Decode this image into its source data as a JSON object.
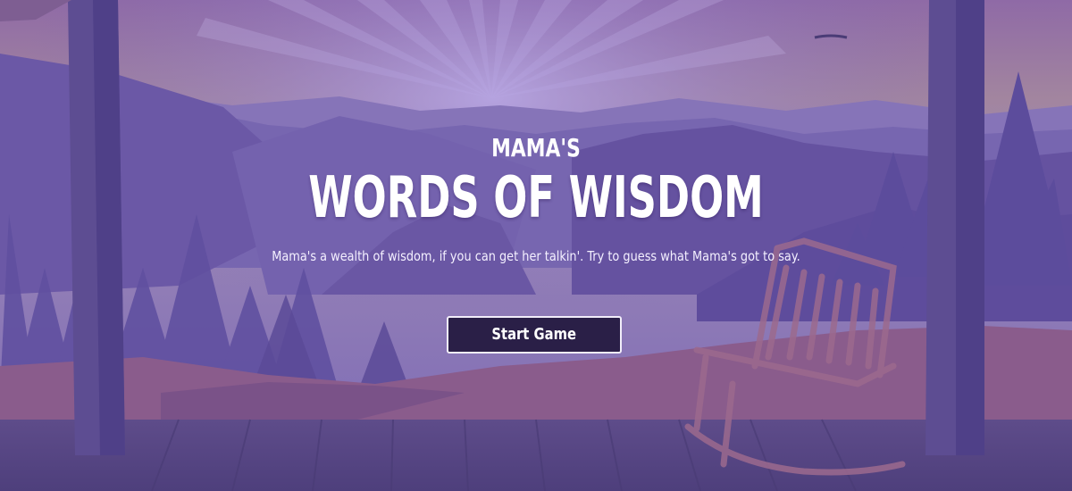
{
  "hero": {
    "subtitle": "MAMA'S",
    "title": "WORDS OF WISDOM",
    "tagline": "Mama's a wealth of wisdom, if you can get her talkin'. Try to guess what Mama's got to say."
  },
  "actions": {
    "start_label": "Start Game"
  },
  "colors": {
    "sky_top": "#8a6aa8",
    "sky_mid": "#a890b0",
    "mountain": "#6f5aa8",
    "porch_floor": "#544584",
    "button_bg": "#2a1f47",
    "button_border": "#f2eefa",
    "text": "#ffffff"
  }
}
